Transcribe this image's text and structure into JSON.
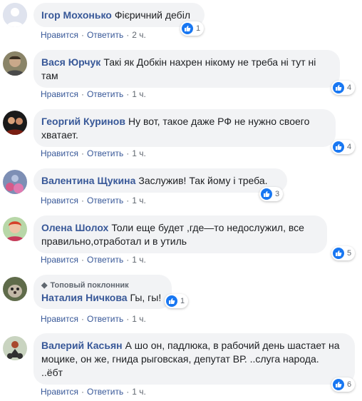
{
  "actions": {
    "like": "Нравится",
    "reply": "Ответить",
    "separator": "·"
  },
  "comments": [
    {
      "author": "Ігор Мохонько",
      "text": "Фієричний дебіл",
      "time": "2 ч.",
      "reactions": "1",
      "badge": ""
    },
    {
      "author": "Вася Юрчук",
      "text": "Такі як Добкін нахрен нікому не треба ні тут ні",
      "text2": "там",
      "time": "1 ч.",
      "reactions": "4",
      "badge": ""
    },
    {
      "author": "Георгий Куринов",
      "text": "Ну вот, такое даже РФ не нужно своего",
      "text2": "хватает.",
      "time": "1 ч.",
      "reactions": "4",
      "badge": ""
    },
    {
      "author": "Валентина Щукина",
      "text": "Заслужив! Так йому і треба.",
      "time": "1 ч.",
      "reactions": "3",
      "badge": ""
    },
    {
      "author": "Олена Шолох",
      "text": "Толи еще будет ,где—то недослужил, все",
      "text2": "правильно,отработал и в утиль",
      "time": "1 ч.",
      "reactions": "5",
      "badge": ""
    },
    {
      "author": "Наталия Ничкова",
      "text": "Гы, гы!",
      "time": "1 ч.",
      "reactions": "1",
      "badge": "Топовый поклонник"
    },
    {
      "author": "Валерий Касьян",
      "text": "А шо он, падлюка, в рабочий день шастает на",
      "text2": "моцике, он же, гнида рыговская, депутат ВР. ..слуга народа.",
      "text3": "..ёбт",
      "time": "1 ч.",
      "reactions": "6",
      "badge": ""
    }
  ],
  "colors": {
    "bubble": "#f2f3f5",
    "author": "#385898",
    "like": "#1877f2",
    "meta": "#606770"
  },
  "icons": {
    "reaction": "like-icon",
    "badge": "diamond-icon"
  }
}
